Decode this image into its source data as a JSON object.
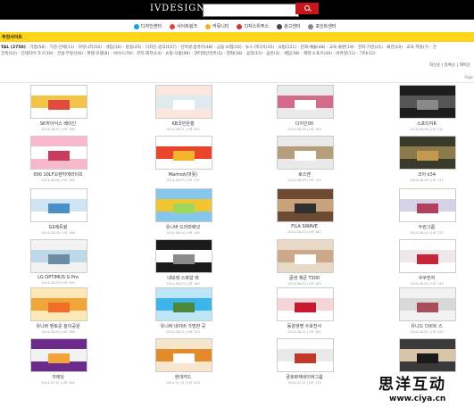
{
  "header": {
    "logo": "IVDESIGN",
    "search_placeholder": "",
    "search_button_icon": "search-icon"
  },
  "menu": [
    {
      "label": "디자인센터",
      "icon": "design-icon",
      "color": "#1a9fd6"
    },
    {
      "label": "사이트링크",
      "icon": "link-icon",
      "color": "#e0453d"
    },
    {
      "label": "커뮤니티",
      "icon": "smile-icon",
      "color": "#f1b21d"
    },
    {
      "label": "디자스위푸스",
      "icon": "pin-icon",
      "color": "#d2372a"
    },
    {
      "label": "광고센터",
      "icon": "broadcast-icon",
      "color": "#444444"
    },
    {
      "label": "포인트센터",
      "icon": "point-icon",
      "color": "#888888"
    }
  ],
  "section_title": "추천사이트",
  "categories": {
    "line1_lead": "TAL (2750)",
    "line1": " · 기업(58) · 기관·단체(11) · 커뮤니티(10) · 게임(16) · 방송(25) · 디자인·광고(107) · 인터넷·컴퓨터(48) · 금융·보험(16) · 뉴스·미디어(35) · 쇼핑(121) · 문화·예술(48) · 교육·출판(19) · 전자·가전(21) · 패션(10) · 교육·학원(7) · 건",
    "line2": "건축(10) · 인테리어·가구(10) · 건설·부동산(6) · 여행·호텔(8) · 서비스(78) · 뷰티·레저(14) · 쇼핑·식품(98) · 엔터테인먼트(5) · 영화(18) · 음악(15) · 음반(3) · 게임(18) · 제약·소포츠(44) · 비쥬얼(11) · 기타(12)"
  },
  "sort": "최신순 | 등록순 | 제목순",
  "paging": "Page",
  "rows": [
    [
      {
        "title": "SK하이닉스 베이인",
        "sub": "2014-08-07 | HIT 186",
        "colors": [
          "#ffffff",
          "#f4c44a",
          "#e24a3b"
        ]
      },
      {
        "title": "KB국민은행",
        "sub": "2014-08-07 | HIT 202",
        "colors": [
          "#fbe6dd",
          "#dfe9f0",
          "#ffffff"
        ]
      },
      {
        "title": "다이인00",
        "sub": "2014-08-06 | HIT 145",
        "colors": [
          "#eaeaea",
          "#d46b8b",
          "#ffffff"
        ]
      },
      {
        "title": "스포티지R",
        "sub": "2014-08-06 | HIT 211",
        "colors": [
          "#1d1d1d",
          "#555555",
          "#8a8a8a"
        ]
      }
    ],
    [
      {
        "title": "000 10LF오렌지에라이프",
        "sub": "2014-08-06 | HIT 169",
        "colors": [
          "#f7b8cb",
          "#ffffff",
          "#c93b5c"
        ]
      },
      {
        "title": "Marmot(마못)",
        "sub": "2014-08-05 | HIT 232",
        "colors": [
          "#ffffff",
          "#e9452c",
          "#f2b42b"
        ]
      },
      {
        "title": "로스앤",
        "sub": "2014-08-05 | HIT 120",
        "colors": [
          "#e9e9e9",
          "#b49f7c",
          "#ffffff"
        ]
      },
      {
        "title": "코아 k34",
        "sub": "2014-08-05 | HIT 174",
        "colors": [
          "#3a3a2a",
          "#8b7a4c",
          "#c49a51"
        ]
      }
    ],
    [
      {
        "title": "GS에듀윌",
        "sub": "2014-08-04 | HIT 198",
        "colors": [
          "#ffffff",
          "#cfe5f3",
          "#4b8fc8"
        ]
      },
      {
        "title": "유니버 드라마배넛",
        "sub": "2014-08-04 | HIT 150",
        "colors": [
          "#86c6ea",
          "#f0c530",
          "#9ed85a"
        ]
      },
      {
        "title": "FILA SWAVE",
        "sub": "2014-08-04 | HIT 187",
        "colors": [
          "#6d4a33",
          "#c7a27b",
          "#2f2f2f"
        ]
      },
      {
        "title": "두란그룹",
        "sub": "2014-08-03 | HIT 157",
        "colors": [
          "#ffffff",
          "#d5d2e8",
          "#b14060"
        ]
      }
    ],
    [
      {
        "title": "LG OPTIMUS G Pro",
        "sub": "2014-08-03 | HIT 305",
        "colors": [
          "#f2f2f2",
          "#bfd8e8",
          "#6c8ca6"
        ]
      },
      {
        "title": "네보레 스파알 렉",
        "sub": "2014-08-03 | HIT 180",
        "colors": [
          "#1b1b1b",
          "#ffffff",
          "#8a8a8a"
        ]
      },
      {
        "title": "굴생 체큰 T300",
        "sub": "2014-08-02 | HIT 155",
        "colors": [
          "#e8d8c6",
          "#caa889",
          "#ffffff"
        ]
      },
      {
        "title": "쿠쿠전자",
        "sub": "2014-08-02 | HIT 143",
        "colors": [
          "#ffffff",
          "#f0e8e8",
          "#c72639"
        ]
      }
    ],
    [
      {
        "title": "유니버 맨토운 놀이공원",
        "sub": "2014-08-02 | HIT 168",
        "colors": [
          "#ffe7b6",
          "#f0a53b",
          "#f06e2a"
        ]
      },
      {
        "title": "유니버 네이버 가방한 곳",
        "sub": "2014-08-01 | HIT 223",
        "colors": [
          "#bde6f9",
          "#3db4ea",
          "#4b8a3a"
        ]
      },
      {
        "title": "동양생명 수호천사",
        "sub": "2014-08-01 | HIT 161",
        "colors": [
          "#ffffff",
          "#f4d6d9",
          "#c7192e"
        ]
      },
      {
        "title": "유니드 다비트 스",
        "sub": "2014-08-01 | HIT 129",
        "colors": [
          "#f2f2f2",
          "#d8d8d8",
          "#a84e5a"
        ]
      }
    ],
    [
      {
        "title": "크레딧",
        "sub": "2014-07-31 | HIT 184",
        "colors": [
          "#6c2a8a",
          "#f2f2f2",
          "#f0a43a"
        ]
      },
      {
        "title": "현대카드",
        "sub": "2014-07-31 | HIT 203",
        "colors": [
          "#f6e6ce",
          "#e38a2a",
          "#ffffff"
        ]
      },
      {
        "title": "금호화재네이버그룹",
        "sub": "2014-07-31 | HIT 175",
        "colors": [
          "#ffffff",
          "#e9e9e9",
          "#c0392b"
        ]
      },
      {
        "title": "",
        "sub": "",
        "colors": [
          "#3a3a3a",
          "#d8c4a8",
          "#1a1a1a"
        ]
      }
    ]
  ],
  "watermark": {
    "title": "思洋互动",
    "url": "www.ciya.cn"
  }
}
